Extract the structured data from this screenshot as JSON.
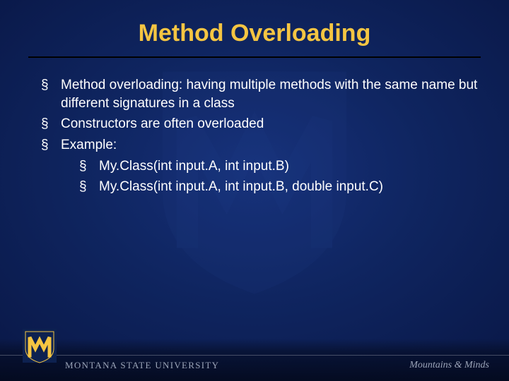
{
  "title": "Method Overloading",
  "bullets": {
    "b1": "Method overloading: having multiple methods with the same name but different signatures in a class",
    "b2": "Constructors are often overloaded",
    "b3": "Example:",
    "sub1": "My.Class(int input.A, int input.B)",
    "sub2": "My.Class(int input.A, int input.B, double input.C)"
  },
  "footer": {
    "university": "MONTANA STATE UNIVERSITY",
    "tagline_left": "Mountains ",
    "tagline_amp": "&",
    "tagline_right": " Minds"
  },
  "colors": {
    "accent": "#f5c542",
    "bg_deep": "#081440"
  }
}
